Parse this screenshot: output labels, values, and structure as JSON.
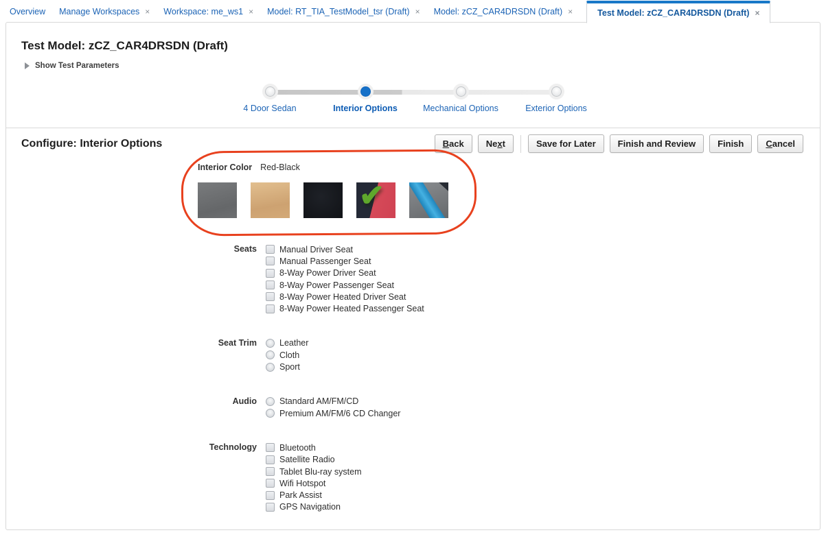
{
  "close_glyph": "×",
  "check_glyph": "✔",
  "tabs": [
    {
      "label": "Overview",
      "active": false,
      "closable": false
    },
    {
      "label": "Manage Workspaces",
      "active": false,
      "closable": true
    },
    {
      "label": "Workspace: me_ws1",
      "active": false,
      "closable": true
    },
    {
      "label": "Model: RT_TIA_TestModel_tsr (Draft)",
      "active": false,
      "closable": true
    },
    {
      "label": "Model: zCZ_CAR4DRSDN (Draft)",
      "active": false,
      "closable": true
    },
    {
      "label": "Test Model: zCZ_CAR4DRSDN (Draft)",
      "active": true,
      "closable": true
    }
  ],
  "page": {
    "title": "Test Model: zCZ_CAR4DRSDN (Draft)",
    "disclosure_label": "Show Test Parameters"
  },
  "train": {
    "steps": [
      {
        "label": "4 Door Sedan",
        "state": "visited"
      },
      {
        "label": "Interior Options",
        "state": "current"
      },
      {
        "label": "Mechanical Options",
        "state": "unvisited"
      },
      {
        "label": "Exterior Options",
        "state": "unvisited"
      }
    ]
  },
  "configure": {
    "heading": "Configure: Interior Options"
  },
  "actions": {
    "back": {
      "pre": "",
      "key": "B",
      "post": "ack"
    },
    "next": {
      "pre": "Ne",
      "key": "x",
      "post": "t"
    },
    "save_for_later": "Save for Later",
    "finish_and_review": "Finish and Review",
    "finish": "Finish",
    "cancel": {
      "pre": "",
      "key": "C",
      "post": "ancel"
    }
  },
  "form": {
    "interior_color": {
      "label": "Interior Color",
      "value": "Red-Black",
      "swatches": [
        {
          "name": "gray-fabric",
          "selected": false
        },
        {
          "name": "tan-leather",
          "selected": false
        },
        {
          "name": "black",
          "selected": false
        },
        {
          "name": "red-black",
          "selected": true
        },
        {
          "name": "blue-gray",
          "selected": false
        }
      ]
    },
    "seats": {
      "label": "Seats",
      "type": "checkbox",
      "options": [
        "Manual Driver Seat",
        "Manual Passenger Seat",
        "8-Way Power Driver Seat",
        "8-Way Power Passenger Seat",
        "8-Way Power Heated Driver Seat",
        "8-Way Power Heated Passenger Seat"
      ]
    },
    "seat_trim": {
      "label": "Seat Trim",
      "type": "radio",
      "options": [
        "Leather",
        "Cloth",
        "Sport"
      ]
    },
    "audio": {
      "label": "Audio",
      "type": "radio",
      "options": [
        "Standard AM/FM/CD",
        "Premium AM/FM/6 CD Changer"
      ]
    },
    "technology": {
      "label": "Technology",
      "type": "checkbox",
      "options": [
        "Bluetooth",
        "Satellite Radio",
        "Tablet Blu-ray system",
        "Wifi Hotspot",
        "Park Assist",
        "GPS Navigation"
      ]
    }
  },
  "colors": {
    "link_blue": "#1b63b5",
    "active_tab_bar": "#1878c8",
    "train_current_blue": "#1570c8",
    "annotation_red": "#e8411e",
    "check_green": "#5fa82c",
    "swatch_gray": "#6f7173",
    "swatch_tan": "#d4ab7c",
    "swatch_black": "#17191d",
    "swatch_navy": "#242936",
    "swatch_red": "#d64a59",
    "swatch_stripe_blue": "#2a97cf"
  }
}
